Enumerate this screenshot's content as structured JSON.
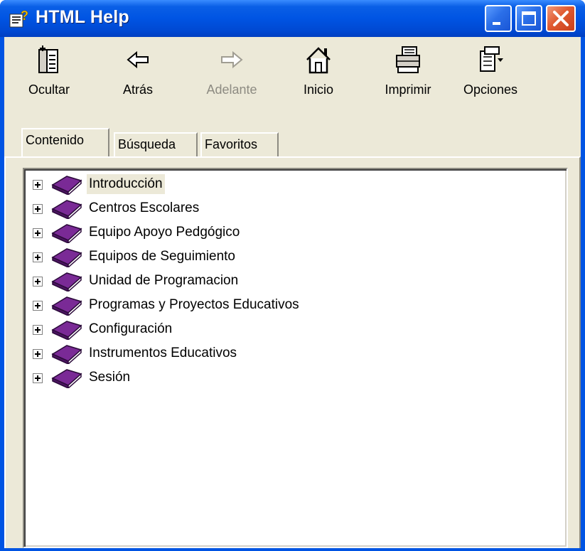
{
  "window": {
    "title": "HTML Help",
    "title_icon": "help-book-icon",
    "controls": {
      "minimize": "minimize-icon",
      "maximize": "maximize-icon",
      "close": "close-icon"
    }
  },
  "toolbar": {
    "items": [
      {
        "label": "Ocultar",
        "icon": "hide-pane-icon",
        "enabled": true
      },
      {
        "label": "Atrás",
        "icon": "back-arrow-icon",
        "enabled": true
      },
      {
        "label": "Adelante",
        "icon": "forward-arrow-icon",
        "enabled": false
      },
      {
        "label": "Inicio",
        "icon": "home-icon",
        "enabled": true
      },
      {
        "label": "Imprimir",
        "icon": "printer-icon",
        "enabled": true
      },
      {
        "label": "Opciones",
        "icon": "options-icon",
        "enabled": true
      }
    ]
  },
  "tabs": [
    {
      "label": "Contenido",
      "active": true
    },
    {
      "label": "Búsqueda",
      "active": false
    },
    {
      "label": "Favoritos",
      "active": false
    }
  ],
  "tree": {
    "items": [
      {
        "label": "Introducción",
        "selected": true
      },
      {
        "label": "Centros Escolares"
      },
      {
        "label": "Equipo Apoyo Pedgógico"
      },
      {
        "label": "Equipos de Seguimiento"
      },
      {
        "label": "Unidad de Programacion"
      },
      {
        "label": "Programas y Proyectos Educativos"
      },
      {
        "label": "Configuración"
      },
      {
        "label": "Instrumentos Educativos"
      },
      {
        "label": "Sesión"
      }
    ]
  },
  "colors": {
    "titlebar": "#0054e3",
    "window_bg": "#ece9d8",
    "book": "#7a2a96",
    "close_button": "#e05a31"
  }
}
